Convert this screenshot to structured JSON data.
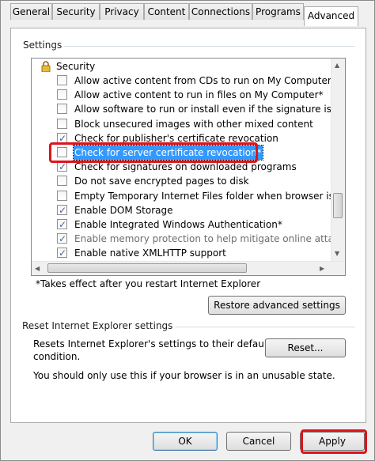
{
  "tabs": [
    "General",
    "Security",
    "Privacy",
    "Content",
    "Connections",
    "Programs",
    "Advanced"
  ],
  "settings_group": {
    "label": "Settings",
    "category": "Security",
    "items": [
      {
        "label": "Allow active content from CDs to run on My Computer*",
        "checked": false
      },
      {
        "label": "Allow active content to run in files on My Computer*",
        "checked": false
      },
      {
        "label": "Allow software to run or install even if the signature is inva",
        "checked": false
      },
      {
        "label": "Block unsecured images with other mixed content",
        "checked": false
      },
      {
        "label": "Check for publisher's certificate revocation",
        "checked": true
      },
      {
        "label": "Check for server certificate revocation*",
        "checked": false
      },
      {
        "label": "Check for signatures on downloaded programs",
        "checked": true
      },
      {
        "label": "Do not save encrypted pages to disk",
        "checked": false
      },
      {
        "label": "Empty Temporary Internet Files folder when browser is clo",
        "checked": false
      },
      {
        "label": "Enable DOM Storage",
        "checked": true
      },
      {
        "label": "Enable Integrated Windows Authentication*",
        "checked": true
      },
      {
        "label": "Enable memory protection to help mitigate online attacks*",
        "checked": true
      },
      {
        "label": "Enable native XMLHTTP support",
        "checked": true
      }
    ],
    "footnote": "*Takes effect after you restart Internet Explorer",
    "restore_button": "Restore advanced settings"
  },
  "reset_group": {
    "label": "Reset Internet Explorer settings",
    "description_line1": "Resets Internet Explorer's settings to their default",
    "description_line2": "condition.",
    "reset_button": "Reset...",
    "warning": "You should only use this if your browser is in an unusable state."
  },
  "footer": {
    "ok": "OK",
    "cancel": "Cancel",
    "apply": "Apply"
  },
  "check_glyph": "✓",
  "colors": {
    "selection": "#3399ff",
    "highlight_box": "#e0121b"
  }
}
